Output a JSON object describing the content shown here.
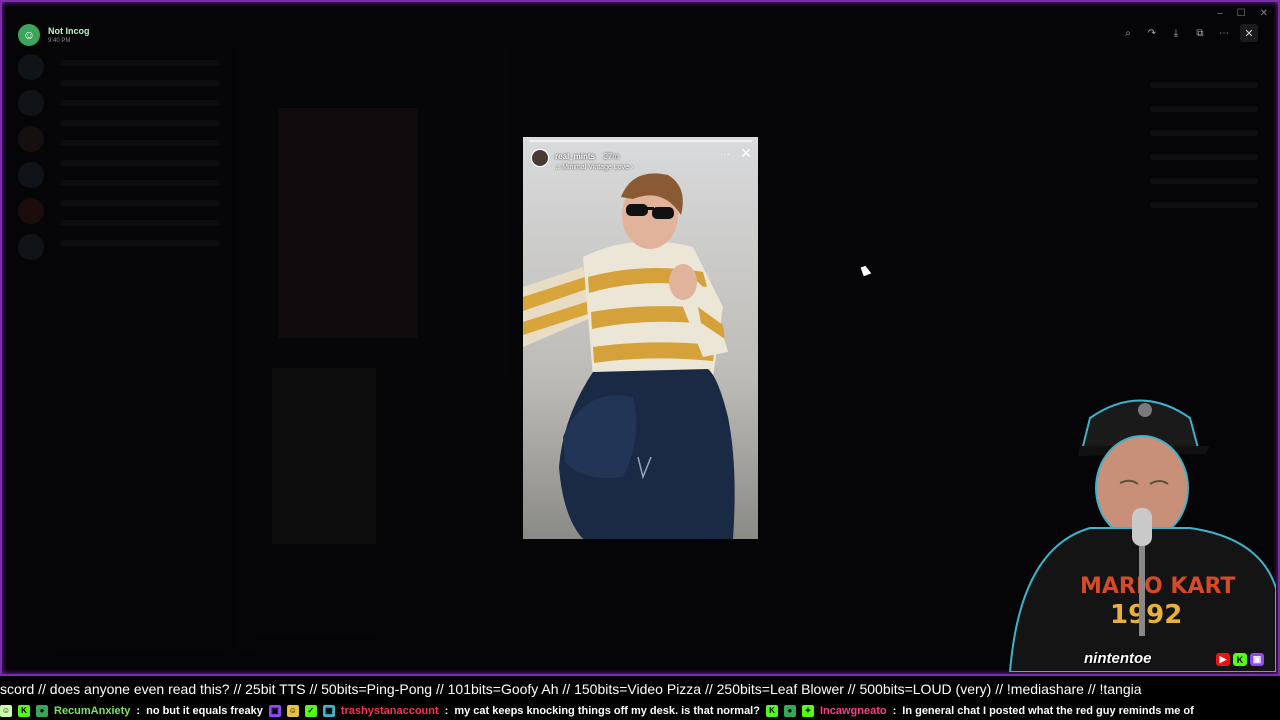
{
  "app": {
    "name": "Not Incog",
    "time": "9:40 PM"
  },
  "window_controls": [
    "–",
    "☐",
    "✕"
  ],
  "viewer": {
    "close_label": "✕"
  },
  "story": {
    "username": "real_mints",
    "age": "27m",
    "music": "♫ Minimal Vintage Love ›",
    "more": "···",
    "close": "✕"
  },
  "overlay": {
    "brand": "nintentoe"
  },
  "ticker": {
    "text": "scord // does anyone even read this? //  25bit TTS // 50bits=Ping-Pong // 101bits=Goofy Ah // 150bits=Video Pizza // 250bits=Leaf Blower // 500bits=LOUD (very) // !mediashare // !tangia"
  },
  "chat": [
    {
      "user": "RecumAnxiety",
      "user_color": "#7ee35b",
      "message": "no but it equals freaky"
    },
    {
      "user": "trashystanaccount",
      "user_color": "#ff2b52",
      "message": "my cat keeps knocking things off my desk. is that normal?"
    },
    {
      "user": "Incawgneato",
      "user_color": "#ff3b8e",
      "message": "In general chat I posted what the red guy reminds me of"
    }
  ],
  "colors": {
    "frame": "#7a2bb0",
    "discord_green": "#3ba55c"
  }
}
